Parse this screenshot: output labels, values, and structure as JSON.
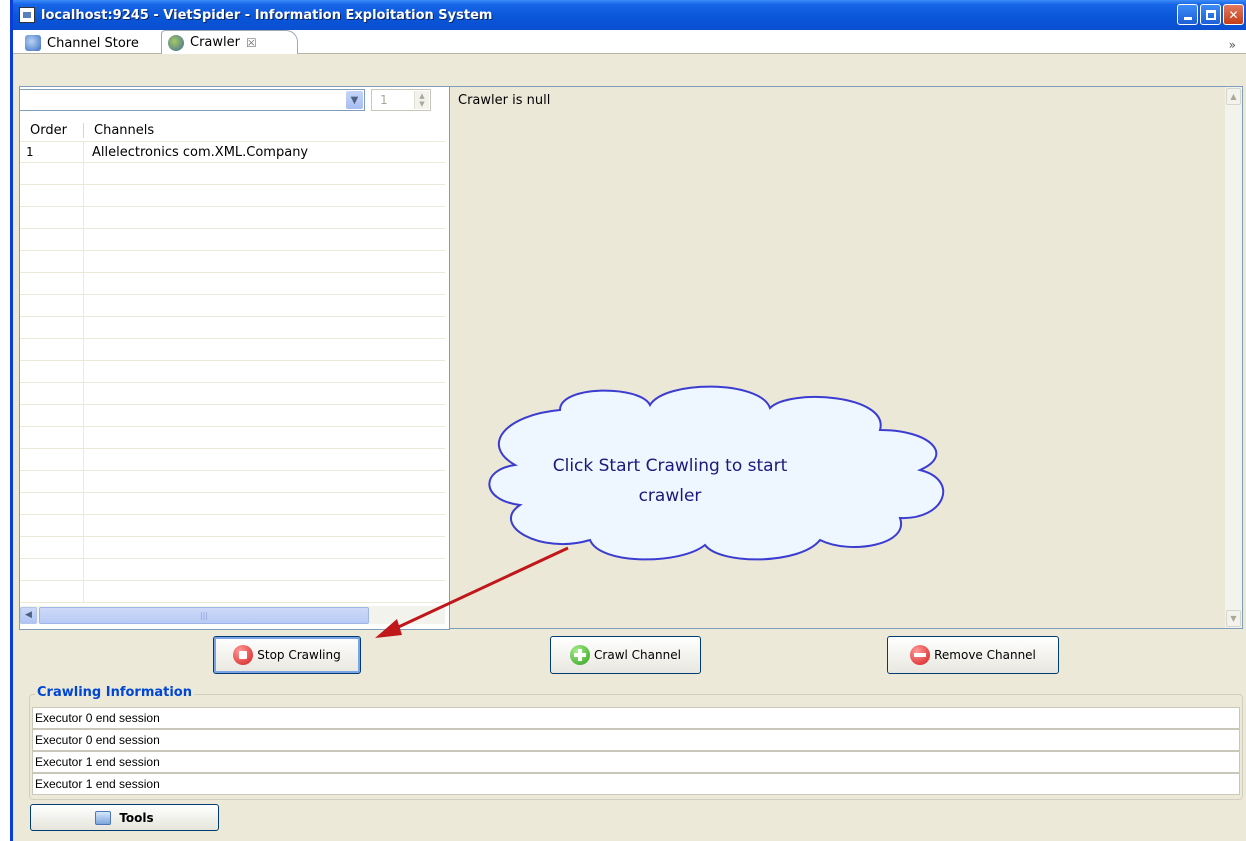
{
  "window": {
    "title": "localhost:9245 - VietSpider - Information Exploitation System"
  },
  "tabs": [
    {
      "label": "Channel Store"
    },
    {
      "label": "Crawler"
    }
  ],
  "left_panel": {
    "combo_value": "",
    "spinner_value": "1",
    "columns": [
      "Order",
      "Channels"
    ],
    "rows": [
      {
        "order": "1",
        "channel": "Allelectronics com.XML.Company"
      }
    ]
  },
  "right_panel": {
    "text": "Crawler is null"
  },
  "buttons": {
    "stop": "Stop Crawling",
    "crawl": "Crawl Channel",
    "remove": "Remove Channel"
  },
  "info": {
    "legend": "Crawling Information",
    "rows": [
      "Executor 0 end session",
      "Executor 0 end session",
      "Executor 1 end session",
      "Executor 1 end session"
    ]
  },
  "tools": {
    "label": "Tools"
  },
  "annotation": {
    "callout": "Click Start Crawling to start crawler"
  },
  "colors": {
    "titlebar": "#0a55d8",
    "legend": "#0046d5",
    "arrow": "#c0171a"
  }
}
